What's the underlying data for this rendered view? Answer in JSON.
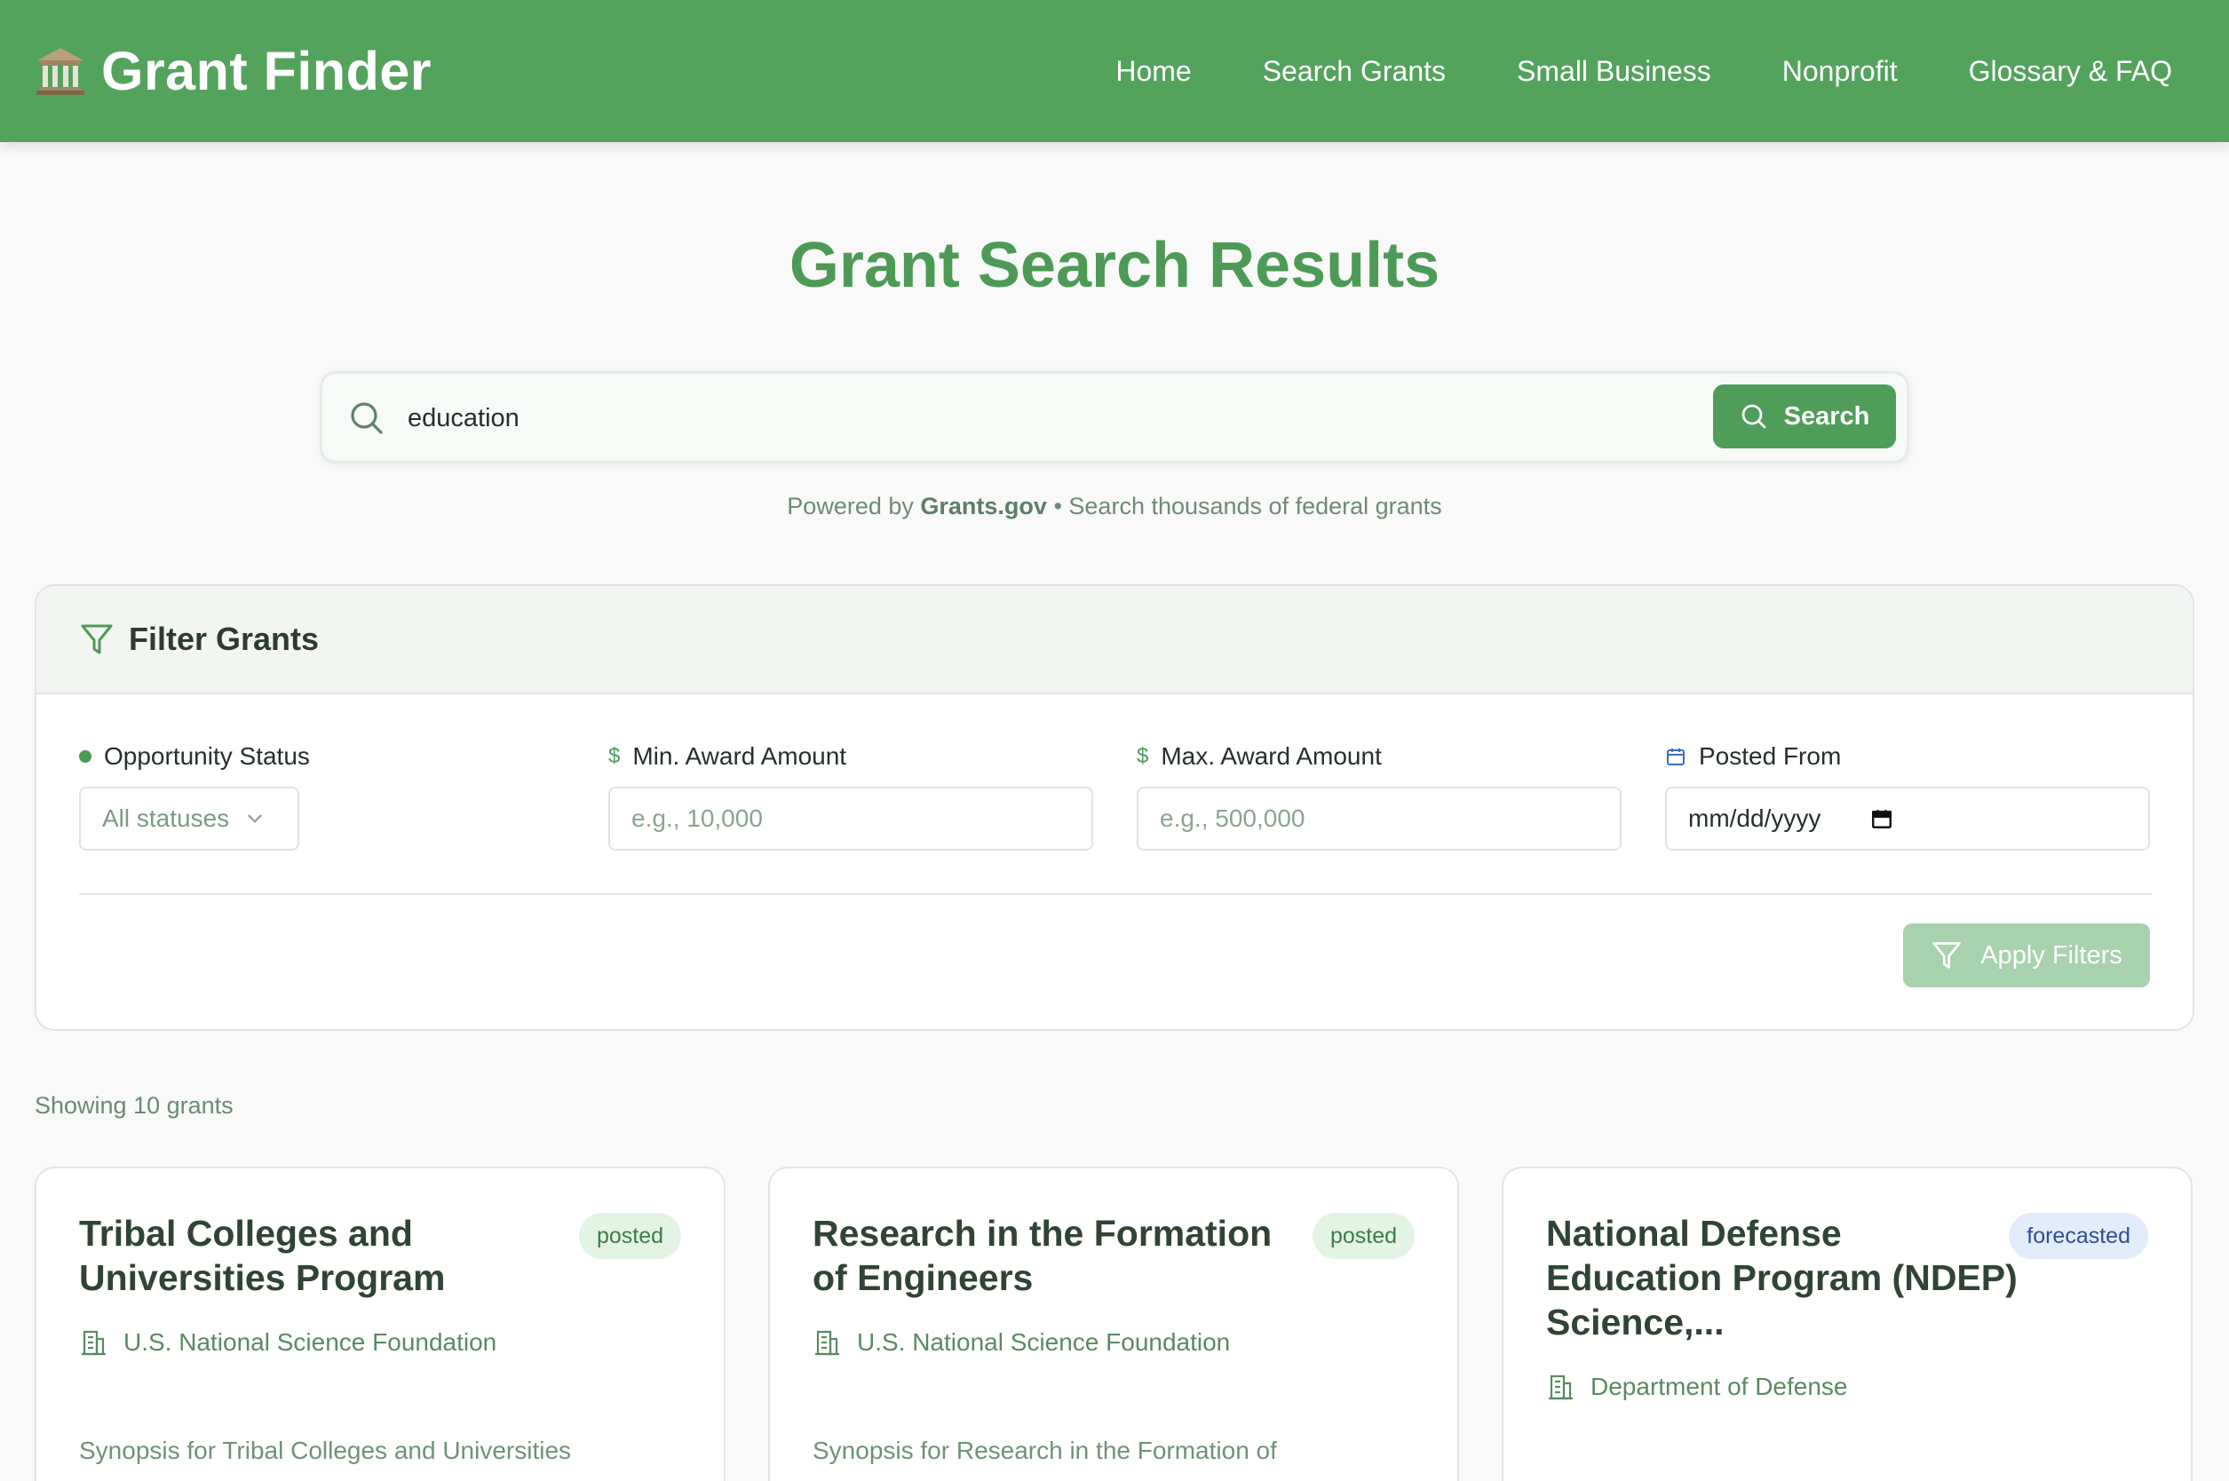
{
  "header": {
    "brand_icon": "bank-building-icon",
    "title": "Grant Finder",
    "nav": [
      "Home",
      "Search Grants",
      "Small Business",
      "Nonprofit",
      "Glossary & FAQ"
    ]
  },
  "page": {
    "title": "Grant Search Results"
  },
  "search": {
    "value": "education",
    "button_label": "Search",
    "powered_prefix": "Powered by",
    "powered_source": "Grants.gov",
    "powered_suffix": "• Search thousands of federal grants"
  },
  "filters": {
    "title": "Filter Grants",
    "status": {
      "label": "Opportunity Status",
      "value": "All statuses"
    },
    "min_award": {
      "label": "Min. Award Amount",
      "placeholder": "e.g., 10,000",
      "icon": "$"
    },
    "max_award": {
      "label": "Max. Award Amount",
      "placeholder": "e.g., 500,000",
      "icon": "$"
    },
    "posted_from": {
      "label": "Posted From",
      "value": "mm/dd/yyyy"
    },
    "apply_label": "Apply Filters"
  },
  "results": {
    "count_text": "Showing 10 grants",
    "cards": [
      {
        "title": "Tribal Colleges and Universities Program",
        "status": "posted",
        "agency": "U.S. National Science Foundation",
        "synopsis": "Synopsis for Tribal Colleges and Universities"
      },
      {
        "title": "Research in the Formation of Engineers",
        "status": "posted",
        "agency": "U.S. National Science Foundation",
        "synopsis": "Synopsis for Research in the Formation of"
      },
      {
        "title": "National Defense Education Program (NDEP) Science,...",
        "status": "forecasted",
        "agency": "Department of Defense",
        "synopsis": ""
      }
    ]
  },
  "colors": {
    "brand_green": "#54a35d",
    "title_green": "#4d9a57",
    "posted_badge_bg": "#e3f4e5",
    "forecasted_badge_bg": "#e3ecfb"
  }
}
